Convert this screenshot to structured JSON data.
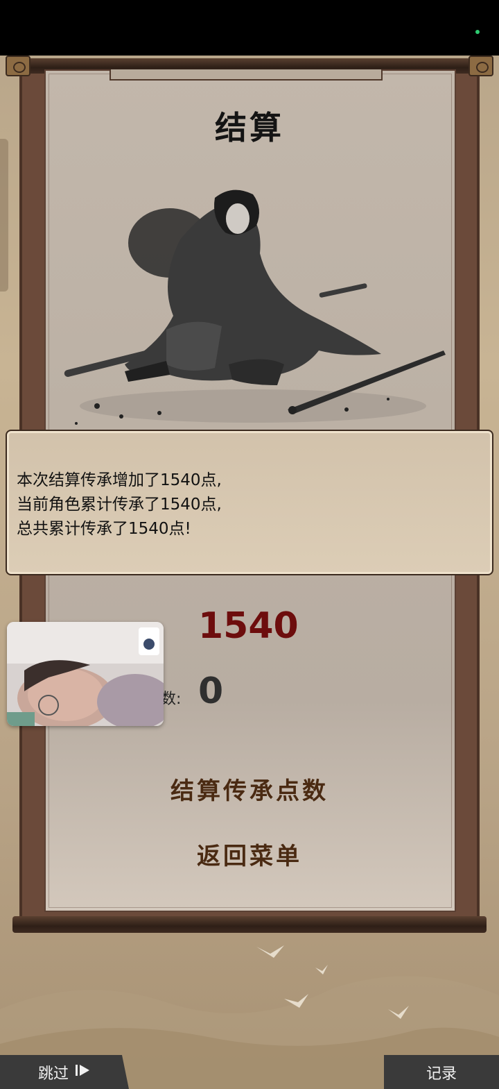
{
  "scroll": {
    "title": "结算"
  },
  "dialog": {
    "lines": [
      "本次结算传承增加了1540点,",
      "当前角色累计传承了1540点,",
      "总共累计传承了1540点!"
    ]
  },
  "stats": {
    "points_value": "1540",
    "count_label_fragment": "数:",
    "count_value": "0",
    "points_label_fragment": ":"
  },
  "menu": {
    "settle_label": "结算传承点数",
    "return_label": "返回菜单"
  },
  "footer": {
    "skip_label": "跳过",
    "skip_icon": "skip-forward-icon",
    "record_label": "记录"
  },
  "colors": {
    "status_dot": "#2ecc71",
    "points_value": "#6d0d0d",
    "menu_text": "#4a2a12"
  }
}
